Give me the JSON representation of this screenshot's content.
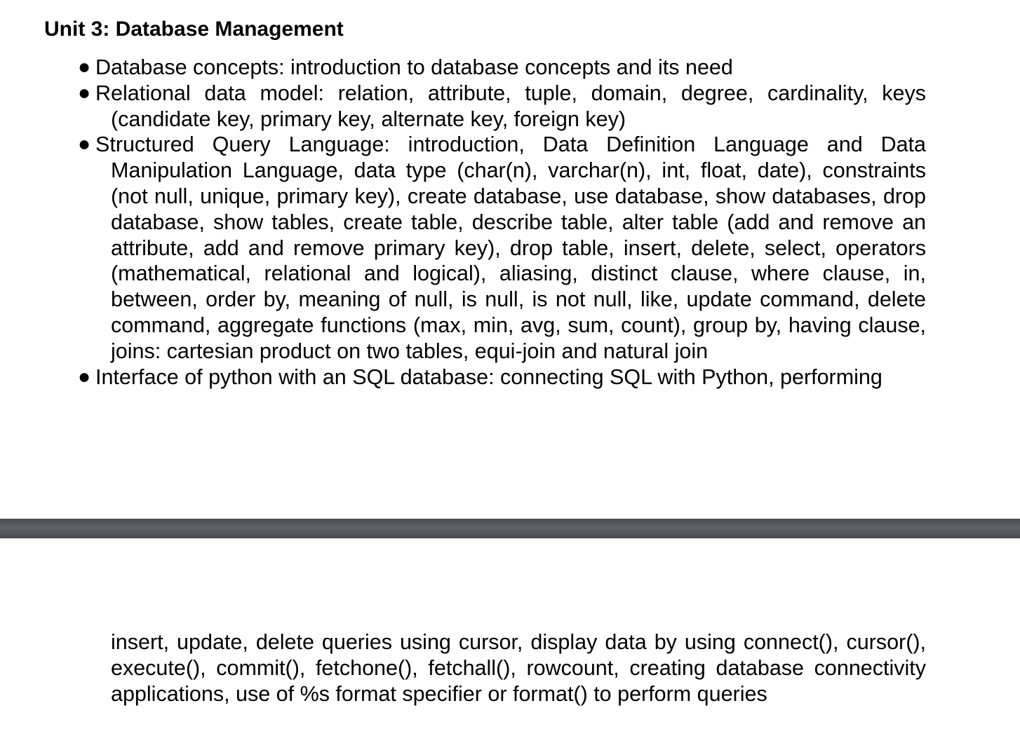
{
  "document": {
    "unit_heading": "Unit 3: Database Management",
    "topics": [
      {
        "text": "Database concepts: introduction to database concepts and its need"
      },
      {
        "text": "Relational data model: relation, attribute, tuple, domain, degree, cardinality, keys (candidate key, primary key, alternate key, foreign key)"
      },
      {
        "text": "Structured Query Language: introduction, Data Definition Language and Data Manipulation Language, data type (char(n), varchar(n), int, float, date), constraints (not null, unique, primary key), create database, use database, show databases, drop database, show tables, create table, describe table, alter table (add and remove an attribute, add and remove primary key), drop table, insert, delete, select, operators (mathematical, relational and logical), aliasing, distinct clause, where clause, in, between, order by, meaning of null, is null, is not null, like, update command, delete command, aggregate functions (max, min, avg, sum, count), group by, having clause, joins: cartesian product on two tables, equi-join and natural join"
      },
      {
        "text": "Interface of python with an SQL database: connecting SQL with Python, performing"
      }
    ],
    "continued_text": "insert, update, delete queries using cursor, display data by using connect(), cursor(), execute(), commit(), fetchone(), fetchall(), rowcount, creating database connectivity applications, use of %s format specifier or format() to perform queries",
    "bullet_glyph": "●"
  }
}
